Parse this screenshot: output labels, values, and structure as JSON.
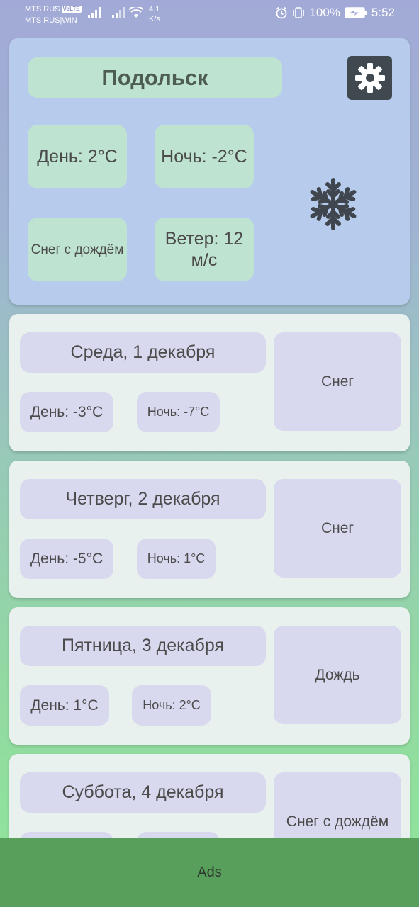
{
  "status_bar": {
    "carrier1": "MTS RUS",
    "volte": "VoLTE",
    "carrier2": "MTS RUS|WIN",
    "speed_value": "4.1",
    "speed_unit": "K/s",
    "battery": "100%",
    "time": "5:52"
  },
  "current": {
    "city": "Подольск",
    "day_temp": "День: 2°C",
    "night_temp": "Ночь: -2°C",
    "condition": "Снег с дождём",
    "wind": "Ветер: 12 м/с",
    "icon": "snowflake-icon"
  },
  "forecast": [
    {
      "date": "Среда, 1 декабря",
      "day": "День: -3°C",
      "night": "Ночь: -7°C",
      "condition": "Снег"
    },
    {
      "date": "Четверг, 2 декабря",
      "day": "День: -5°C",
      "night": "Ночь: 1°C",
      "condition": "Снег"
    },
    {
      "date": "Пятница, 3 декабря",
      "day": "День: 1°C",
      "night": "Ночь: 2°C",
      "condition": "Дождь"
    },
    {
      "date": "Суббота, 4 декабря",
      "day": "",
      "night": "",
      "condition": "Снег с дождём"
    }
  ],
  "ads": {
    "label": "Ads"
  },
  "colors": {
    "current_card": "#b7ccec",
    "city_pill": "#bfe3d1",
    "day_card": "#e8f1ee",
    "day_pill": "#d8d8ef",
    "settings_button": "#404850",
    "ads_banner": "#579f5a"
  }
}
